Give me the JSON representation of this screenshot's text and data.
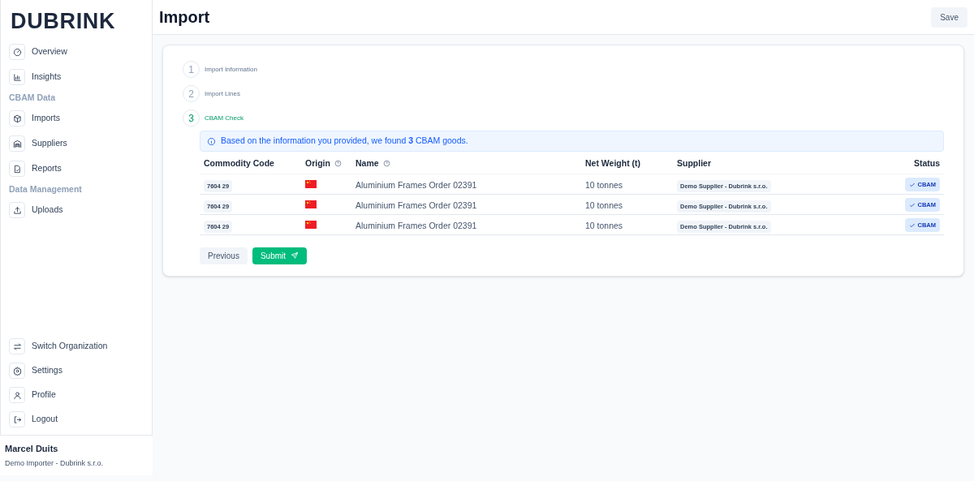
{
  "brand": "DUBRINK",
  "nav_sections": [
    {
      "items": [
        {
          "label": "Overview",
          "selected": false
        },
        {
          "label": "Insights",
          "selected": false
        }
      ]
    },
    {
      "title": "CBAM Data",
      "items": [
        {
          "label": "Imports",
          "selected": false
        },
        {
          "label": "Suppliers",
          "selected": false
        },
        {
          "label": "Reports",
          "selected": false
        }
      ]
    },
    {
      "title": "Data Management",
      "items": [
        {
          "label": "Uploads",
          "selected": false
        }
      ]
    }
  ],
  "bottom_nav": [
    {
      "label": "Switch Organization"
    },
    {
      "label": "Settings"
    },
    {
      "label": "Profile"
    },
    {
      "label": "Logout"
    }
  ],
  "user": {
    "name": "Marcel Duits",
    "org": "Demo Importer - Dubrink s.r.o."
  },
  "header": {
    "title": "Import",
    "save": "Save"
  },
  "steps": [
    {
      "number": "1",
      "label": "Import Information",
      "selected": false
    },
    {
      "number": "2",
      "label": "Import Lines",
      "selected": false
    },
    {
      "number": "3",
      "label": "CBAM Check",
      "selected": true
    }
  ],
  "notice": "Based on the information you provided, we found **3** CBAM goods.",
  "table": {
    "columns": [
      {
        "label": "Commodity Code",
        "help": false
      },
      {
        "label": "Origin",
        "help": true
      },
      {
        "label": "Name",
        "help": true
      },
      {
        "label": "Net Weight (t)",
        "help": false
      },
      {
        "label": "Supplier",
        "help": false
      },
      {
        "label": "Status",
        "help": false
      }
    ],
    "rows": [
      {
        "code": "7604 29",
        "name": "Aluminium Frames Order 02391",
        "weight": "10 tonnes",
        "supplier": "Demo Supplier - Dubrink s.r.o.",
        "status": "CBAM"
      },
      {
        "code": "7604 29",
        "name": "Aluminium Frames Order 02391",
        "weight": "10 tonnes",
        "supplier": "Demo Supplier - Dubrink s.r.o.",
        "status": "CBAM"
      },
      {
        "code": "7604 29",
        "name": "Aluminium Frames Order 02391",
        "weight": "10 tonnes",
        "supplier": "Demo Supplier - Dubrink s.r.o.",
        "status": "CBAM"
      }
    ]
  },
  "buttons": {
    "previous": "Previous",
    "submit": "Submit"
  }
}
